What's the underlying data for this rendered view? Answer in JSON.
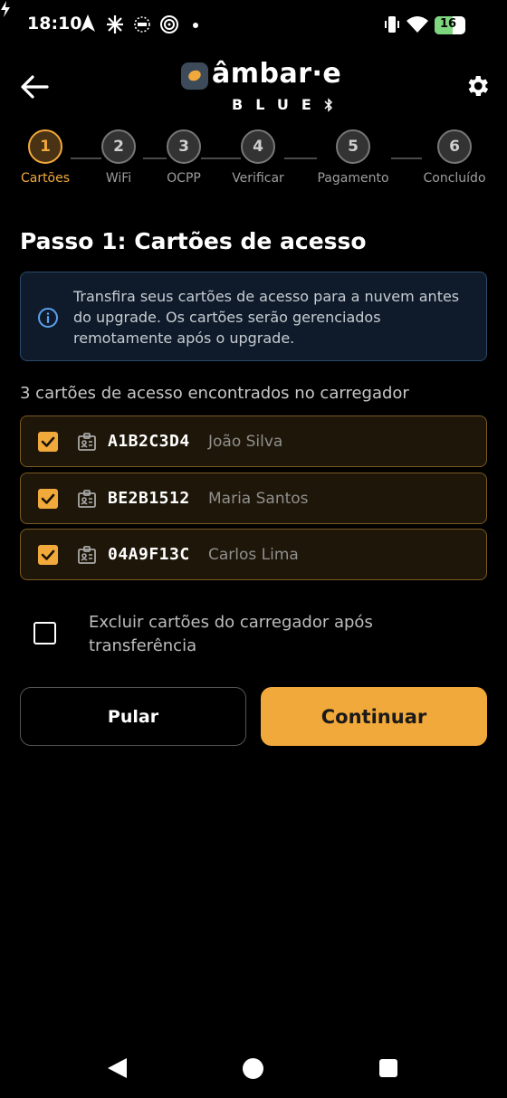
{
  "status_bar": {
    "time": "18:10",
    "battery_level": "16",
    "icons": [
      "navigation-icon",
      "pinwheel-icon",
      "film-icon",
      "spiral-icon",
      "dot-icon",
      "vibrate-icon",
      "wifi-icon",
      "battery-icon",
      "charging-icon"
    ]
  },
  "header": {
    "logo_word": "âmbar·e",
    "logo_sub": "BLUE",
    "back_icon": "arrow-left-icon",
    "settings_icon": "gear-icon"
  },
  "stepper": {
    "steps": [
      {
        "number": "1",
        "label": "Cartões",
        "active": true
      },
      {
        "number": "2",
        "label": "WiFi",
        "active": false
      },
      {
        "number": "3",
        "label": "OCPP",
        "active": false
      },
      {
        "number": "4",
        "label": "Verificar",
        "active": false
      },
      {
        "number": "5",
        "label": "Pagamento",
        "active": false
      },
      {
        "number": "6",
        "label": "Concluído",
        "active": false
      }
    ]
  },
  "page_title": "Passo 1: Cartões de acesso",
  "info": {
    "text": "Transfira seus cartões de acesso para a nuvem antes do upgrade. Os cartões serão gerenciados remotamente após o upgrade."
  },
  "count_text": "3 cartões de acesso encontrados no carregador",
  "cards": [
    {
      "uid": "A1B2C3D4",
      "owner": "João Silva",
      "checked": true
    },
    {
      "uid": "BE2B1512",
      "owner": "Maria Santos",
      "checked": true
    },
    {
      "uid": "04A9F13C",
      "owner": "Carlos Lima",
      "checked": true
    }
  ],
  "delete_option": {
    "label": "Excluir cartões do carregador após transferência",
    "checked": false
  },
  "buttons": {
    "skip": "Pular",
    "continue": "Continuar"
  },
  "colors": {
    "accent": "#f2a93b",
    "background": "#000000",
    "card_background": "#1e1608",
    "info_background": "#0f1b2a"
  }
}
